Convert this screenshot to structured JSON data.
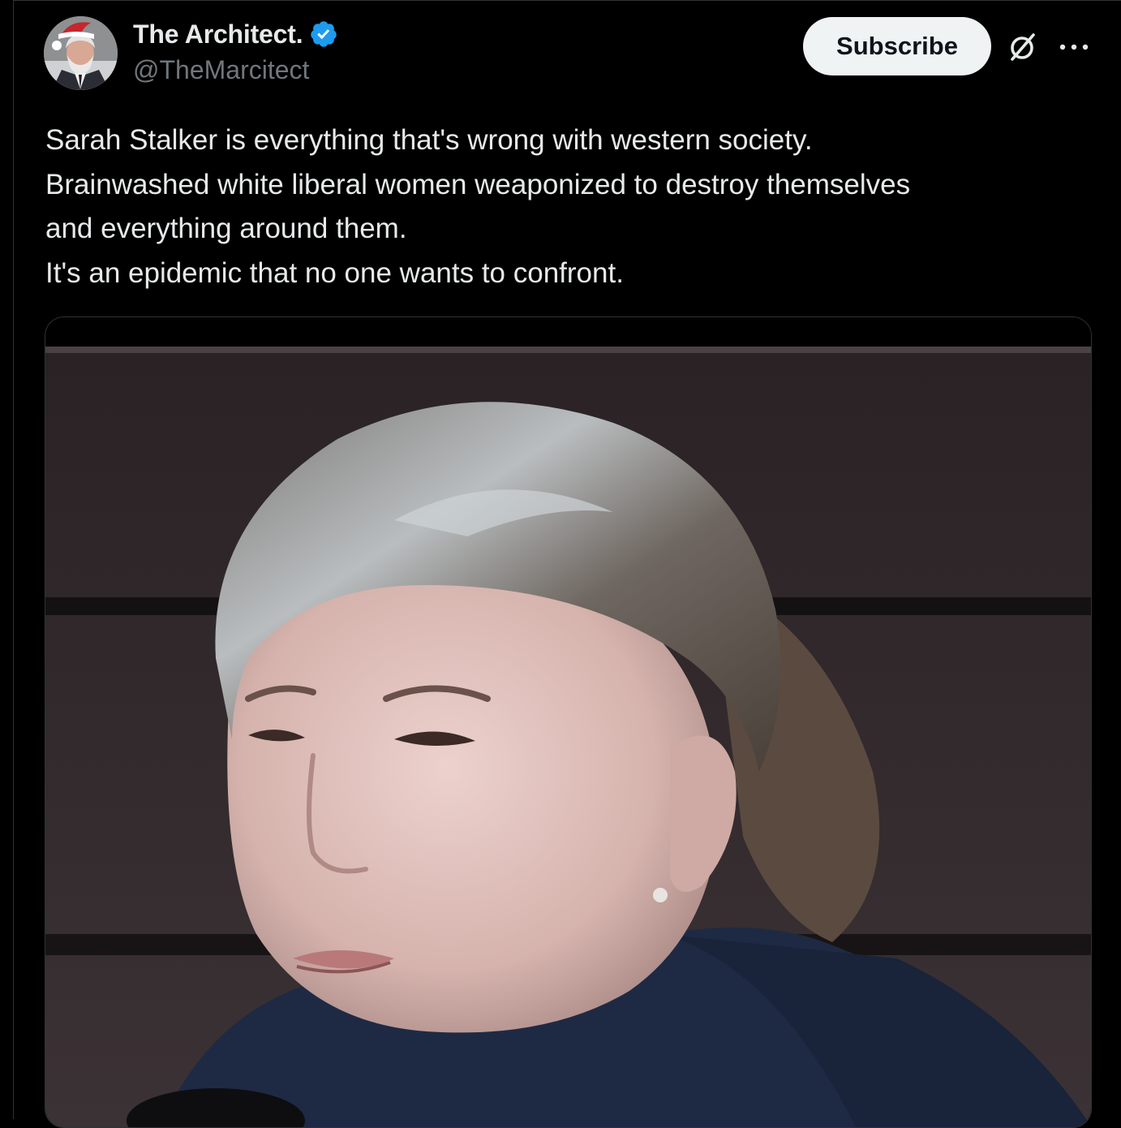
{
  "author": {
    "display_name": "The Architect.",
    "handle": "@TheMarcitect",
    "verified": true,
    "verified_color": "#1d9bf0",
    "avatar_icon": "profile-photo-santa-hat"
  },
  "actions": {
    "subscribe_label": "Subscribe",
    "grok_icon": "grok-icon",
    "more_icon": "more-options-icon"
  },
  "tweet": {
    "lines": [
      "Sarah Stalker is everything that's wrong with western society.",
      "Brainwashed white liberal women weaponized to destroy themselves",
      "and everything around them.",
      "It's an epidemic that no one wants to confront."
    ]
  },
  "media": {
    "type": "video-still",
    "subject": "woman-with-gray-streaked-hair-speaking"
  },
  "colors": {
    "background": "#000000",
    "text_primary": "#e7e9ea",
    "text_secondary": "#71767b",
    "border": "#2f3336",
    "button_bg": "#eff3f4"
  }
}
